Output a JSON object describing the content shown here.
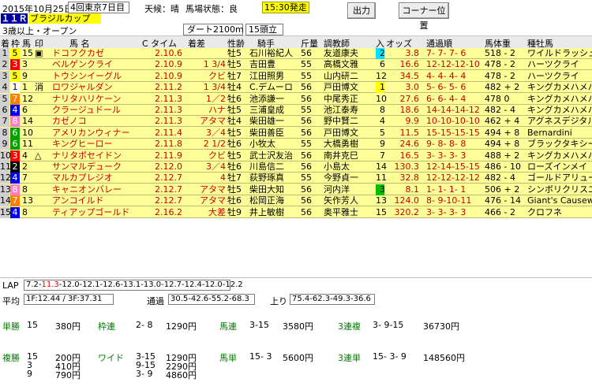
{
  "top": {
    "date": "2015年10月25日",
    "meeting": "4回東京7日目",
    "weather_label": "天候：晴",
    "track_label": "馬場状態：良",
    "post_time": "15:30発走",
    "race_no": "１１Ｒ",
    "race_name": "ブラジルカップ",
    "race_class": "3歳以上・オープン",
    "course": "ダート2100m",
    "runners": "15頭立"
  },
  "buttons": {
    "output": "出力",
    "corner": "コーナー位置"
  },
  "header": {
    "chaku": "着",
    "waku": "枠",
    "uma": "馬",
    "shirushi": "印",
    "name": "馬 名",
    "time": "C タイム",
    "margin": "着差",
    "sexage": "性齢",
    "jockey": "騎手",
    "weight": "斤量",
    "trainer": "調教師",
    "nyu": "入",
    "odds": "オッズ",
    "passing": "通過順",
    "bodyweight": "馬体重",
    "sire": "種牡馬"
  },
  "rows": [
    {
      "pos": "1",
      "waku": "5",
      "num": "15",
      "mark": "▣",
      "name": "ドコフクカゼ",
      "time": "2.10.6",
      "margin": "",
      "sex": "牡5",
      "jockey": "石川裕紀人",
      "wt": "56",
      "trainer": "友道康夫",
      "nyu": "2",
      "pop": "2",
      "odds": "3.8",
      "pass": "7- 7- 7- 6",
      "bw": "518 - 2",
      "sire": "ワイルドラッシュ"
    },
    {
      "pos": "2",
      "waku": "3",
      "num": "3",
      "mark": "",
      "name": "ベルゲンクライ",
      "time": "2.10.9",
      "margin": "1 3/4",
      "sex": "牡5",
      "jockey": "吉田豊",
      "wt": "55",
      "trainer": "高橋文雅",
      "nyu": "",
      "pop": "6",
      "odds": "16.6",
      "pass": "12-12-12-10",
      "bw": "478 - 2",
      "sire": "ハーツクライ"
    },
    {
      "pos": "3",
      "waku": "5",
      "num": "9",
      "mark": "",
      "name": "トウシンイーグル",
      "time": "2.10.9",
      "margin": "クビ",
      "sex": "牡7",
      "jockey": "江田照男",
      "wt": "55",
      "trainer": "山内研二",
      "nyu": "",
      "pop": "12",
      "odds": "34.5",
      "pass": "4- 4- 4- 4",
      "bw": "478 - 2",
      "sire": "ハーツクライ"
    },
    {
      "pos": "4",
      "waku": "1",
      "num": "1",
      "mark": "消",
      "name": "ロワジャルダン",
      "time": "2.11.2",
      "margin": "1 3/4",
      "sex": "牡4",
      "jockey": "C.デムーロ",
      "wt": "56",
      "trainer": "戸田博文",
      "nyu": "1",
      "pop": "1",
      "odds": "3.0",
      "pass": "5- 6- 5- 6",
      "bw": "482 + 2",
      "sire": "キングカメハメハ"
    },
    {
      "pos": "5",
      "waku": "7",
      "num": "12",
      "mark": "",
      "name": "ナリタハリケーン",
      "time": "2.11.3",
      "margin": "1／2",
      "sex": "牡6",
      "jockey": "池添謙一",
      "wt": "56",
      "trainer": "中尾秀正",
      "nyu": "",
      "pop": "10",
      "odds": "27.6",
      "pass": "6- 6- 4- 4",
      "bw": "478 0",
      "sire": "キングカメハメハ"
    },
    {
      "pos": "6",
      "waku": "4",
      "num": "6",
      "mark": "",
      "name": "クラージュドール",
      "time": "2.11.3",
      "margin": "ハナ",
      "sex": "牡5",
      "jockey": "三浦皇成",
      "wt": "55",
      "trainer": "池江泰寿",
      "nyu": "",
      "pop": "8",
      "odds": "18.6",
      "pass": "14-14-14-12",
      "bw": "482 - 4",
      "sire": "キングカメハメハ"
    },
    {
      "pos": "7",
      "waku": "8",
      "num": "14",
      "mark": "",
      "name": "カゼノコ",
      "time": "2.11.3",
      "margin": "アタマ",
      "sex": "牡4",
      "jockey": "柴田雄一",
      "wt": "56",
      "trainer": "野中賢二",
      "nyu": "",
      "pop": "4",
      "odds": "9.9",
      "pass": "10-10-10-10",
      "bw": "462 + 4",
      "sire": "アグネスデジタル"
    },
    {
      "pos": "8",
      "waku": "6",
      "num": "10",
      "mark": "",
      "name": "アメリカンウィナー",
      "time": "2.11.4",
      "margin": "3／4",
      "sex": "牡5",
      "jockey": "柴田善臣",
      "wt": "56",
      "trainer": "戸田博文",
      "nyu": "",
      "pop": "5",
      "odds": "11.5",
      "pass": "15-15-15-15",
      "bw": "494 + 8",
      "sire": "Bernardini"
    },
    {
      "pos": "9",
      "waku": "6",
      "num": "11",
      "mark": "",
      "name": "キングヒーロー",
      "time": "2.11.8",
      "margin": "2 1/2",
      "sex": "牡6",
      "jockey": "小牧太",
      "wt": "55",
      "trainer": "大橋勇樹",
      "nyu": "",
      "pop": "9",
      "odds": "24.6",
      "pass": "9- 8- 8- 8",
      "bw": "494 + 8",
      "sire": "ブラックタキシード"
    },
    {
      "pos": "10",
      "waku": "3",
      "num": "4",
      "mark": "△",
      "name": "ナリタポセイドン",
      "time": "2.11.9",
      "margin": "クビ",
      "sex": "牡5",
      "jockey": "武士沢友治",
      "wt": "56",
      "trainer": "南井克巳",
      "nyu": "",
      "pop": "7",
      "odds": "16.5",
      "pass": "3- 3- 3- 3",
      "bw": "488 + 2",
      "sire": "キングカメハメハ"
    },
    {
      "pos": "11",
      "waku": "2",
      "num": "2",
      "mark": "",
      "name": "サンマルデューク",
      "time": "2.12.0",
      "margin": "3／4",
      "sex": "牡6",
      "jockey": "川島信二",
      "wt": "56",
      "trainer": "小島太",
      "nyu": "",
      "pop": "14",
      "odds": "130.3",
      "pass": "12-14-15-15",
      "bw": "486 - 10",
      "sire": "ローズインメイ"
    },
    {
      "pos": "12",
      "waku": "4",
      "num": "7",
      "mark": "",
      "name": "マルカプレジオ",
      "time": "2.12.7",
      "margin": "4",
      "sex": "牡7",
      "jockey": "荻野琢真",
      "wt": "55",
      "trainer": "今野貞一",
      "nyu": "",
      "pop": "11",
      "odds": "32.8",
      "pass": "12-12-12-12",
      "bw": "482 - 4",
      "sire": "ゴールドアリュール"
    },
    {
      "pos": "13",
      "waku": "8",
      "num": "8",
      "mark": "",
      "name": "キャニオンバレー",
      "time": "2.12.7",
      "margin": "アタマ",
      "sex": "牡5",
      "jockey": "柴田大知",
      "wt": "56",
      "trainer": "河内洋",
      "nyu": "3",
      "pop": "3",
      "odds": "8.1",
      "pass": "1- 1- 1- 1",
      "bw": "506 + 2",
      "sire": "シンボリクリスエス"
    },
    {
      "pos": "14",
      "waku": "7",
      "num": "13",
      "mark": "",
      "name": "アンコイルド",
      "time": "2.12.7",
      "margin": "アタマ",
      "sex": "牡6",
      "jockey": "松岡正海",
      "wt": "56",
      "trainer": "矢作芳人",
      "nyu": "",
      "pop": "13",
      "odds": "124.0",
      "pass": "8- 9-10-11",
      "bw": "476 - 14",
      "sire": "Giant's Causeway"
    },
    {
      "pos": "15",
      "waku": "4",
      "num": "8",
      "mark": "",
      "name": "ティアップゴールド",
      "time": "2.16.2",
      "margin": "大差",
      "sex": "牡9",
      "jockey": "井上敏樹",
      "wt": "56",
      "trainer": "奥平雅士",
      "nyu": "",
      "pop": "15",
      "odds": "320.2",
      "pass": "3- 3- 3- 3",
      "bw": "466 - 2",
      "sire": "クロフネ"
    }
  ],
  "laps": {
    "lap_label": "LAP",
    "lap_prefix": "7.2-",
    "lap_red": "11.3",
    "lap_rest": "-12.0-12.1-12.6-13.1-13.0-12.7-12.4-12.0-12.2",
    "avg_label": "平均",
    "avg_value": "1F:12.44 / 3F:37.31",
    "pass_label": "通過",
    "pass_value": "30.5-42.6-55.2-68.3",
    "agari_label": "上り",
    "agari_value": "75.4-62.3-49.3-36.6"
  },
  "payouts": {
    "tansho_label": "単勝",
    "tansho": [
      [
        "15",
        "380円"
      ]
    ],
    "wakuren_label": "枠連",
    "wakuren": [
      [
        "2- 8",
        "1290円"
      ]
    ],
    "umaren_label": "馬連",
    "umaren": [
      [
        "3-15",
        "3580円"
      ]
    ],
    "sanrenpuku_label": "3連複",
    "sanrenpuku": [
      [
        "3- 9-15",
        "36730円"
      ]
    ],
    "fukusho_label": "複勝",
    "fukusho": [
      [
        "15",
        "200円"
      ],
      [
        "3",
        "410円"
      ],
      [
        "9",
        "790円"
      ]
    ],
    "wide_label": "ワイド",
    "wide": [
      [
        "3-15",
        "1290円"
      ],
      [
        "9-15",
        "2290円"
      ],
      [
        "3- 9",
        "4860円"
      ]
    ],
    "umatan_label": "馬単",
    "umatan": [
      [
        "15- 3",
        "5600円"
      ]
    ],
    "sanrentan_label": "3連単",
    "sanrentan": [
      [
        "15- 3- 9",
        "148560円"
      ]
    ]
  },
  "colors": {
    "waku1": "#ffffff",
    "waku2": "#000000",
    "waku3": "#ff0000",
    "waku4": "#0000ff",
    "waku5": "#ffff00",
    "waku6": "#00a000",
    "waku7": "#ff8000",
    "waku8": "#ff80c0",
    "grid_bg": "#ffff9a",
    "header_bg": "#eaeaea",
    "pay_label": "#008000"
  }
}
